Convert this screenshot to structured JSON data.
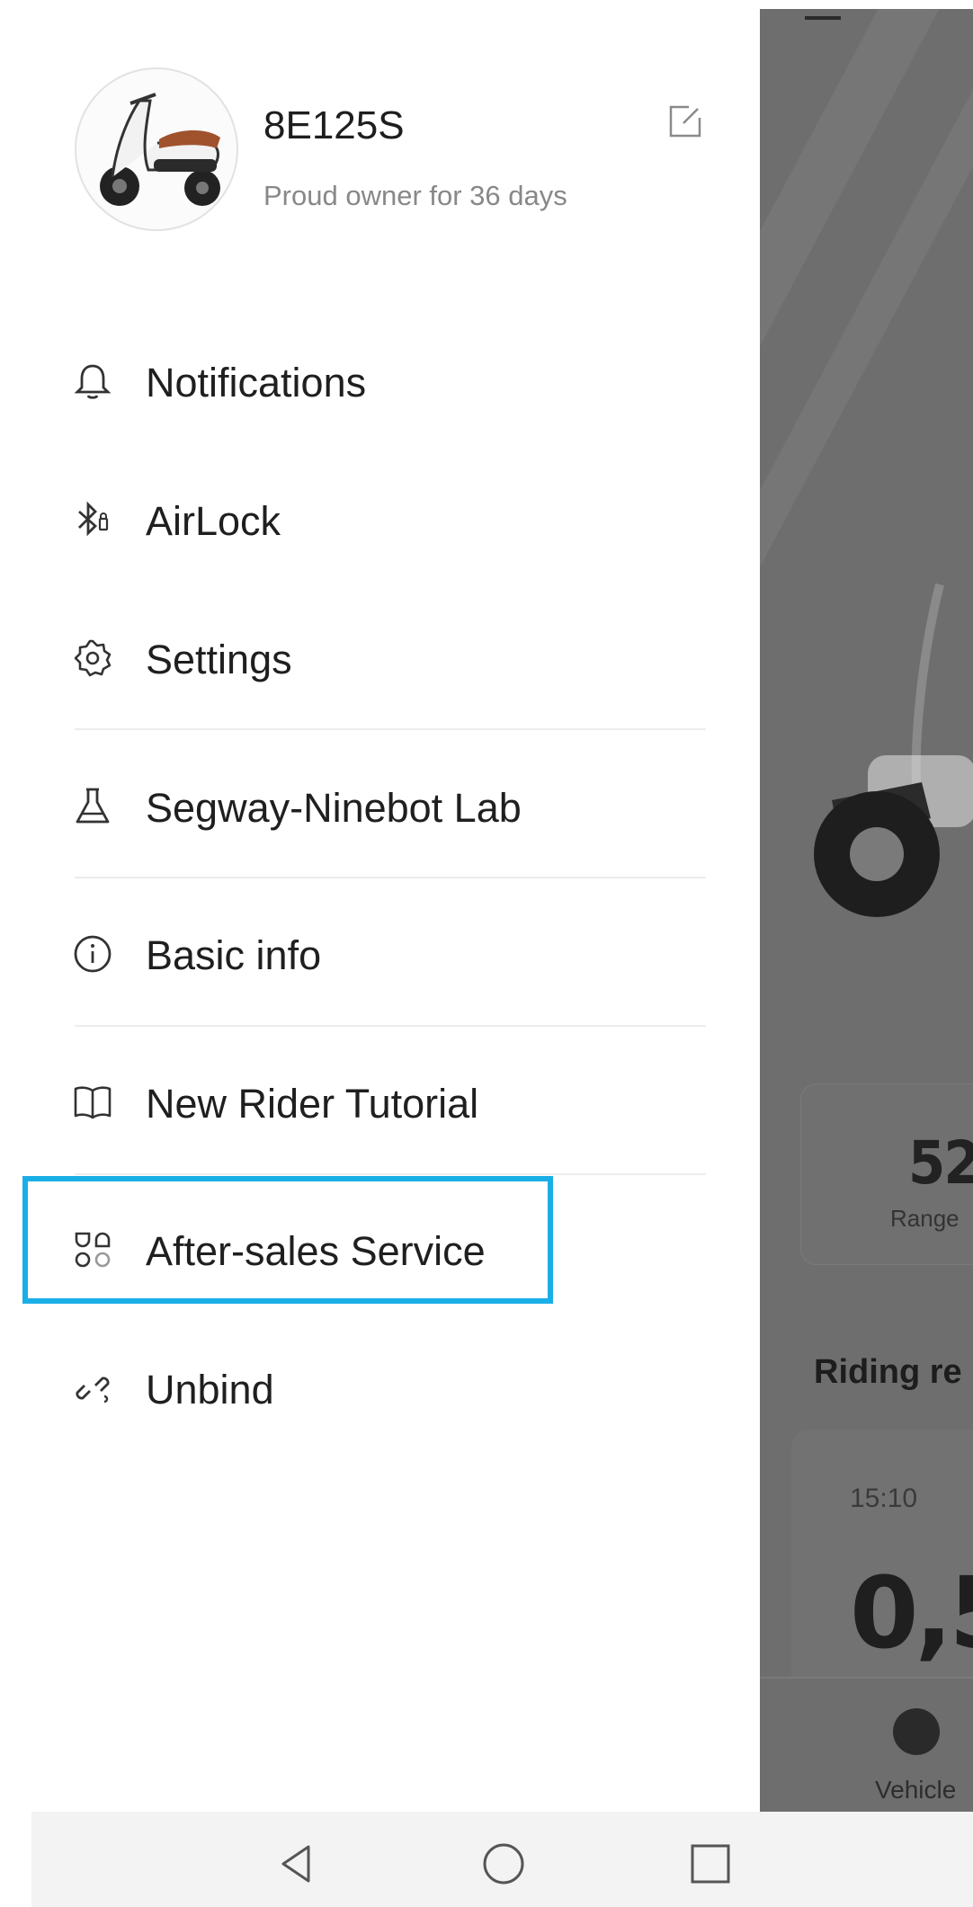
{
  "drawer": {
    "vehicle_name": "8E125S",
    "owner_text": "Proud owner for 36 days",
    "menu": [
      {
        "id": "notifications",
        "label": "Notifications",
        "icon": "bell-icon"
      },
      {
        "id": "airlock",
        "label": "AirLock",
        "icon": "bluetooth-icon"
      },
      {
        "id": "settings",
        "label": "Settings",
        "icon": "gear-icon"
      },
      {
        "id": "lab",
        "label": "Segway-Ninebot Lab",
        "icon": "flask-icon"
      },
      {
        "id": "basic-info",
        "label": "Basic info",
        "icon": "info-icon"
      },
      {
        "id": "tutorial",
        "label": "New Rider Tutorial",
        "icon": "book-icon"
      },
      {
        "id": "after-sales",
        "label": "After-sales Service",
        "icon": "apps-icon"
      },
      {
        "id": "unbind",
        "label": "Unbind",
        "icon": "unlink-icon"
      }
    ],
    "highlighted_item": "after-sales",
    "highlight_color": "#19aee6"
  },
  "background_app": {
    "stat_value": "52,",
    "stat_label": "Range",
    "riding_title": "Riding re",
    "ride_time": "15:10",
    "ride_distance": "0,5",
    "bottom_tab_label": "Vehicle"
  },
  "system_nav": {
    "buttons": [
      "back-icon",
      "home-icon",
      "recents-icon"
    ]
  }
}
